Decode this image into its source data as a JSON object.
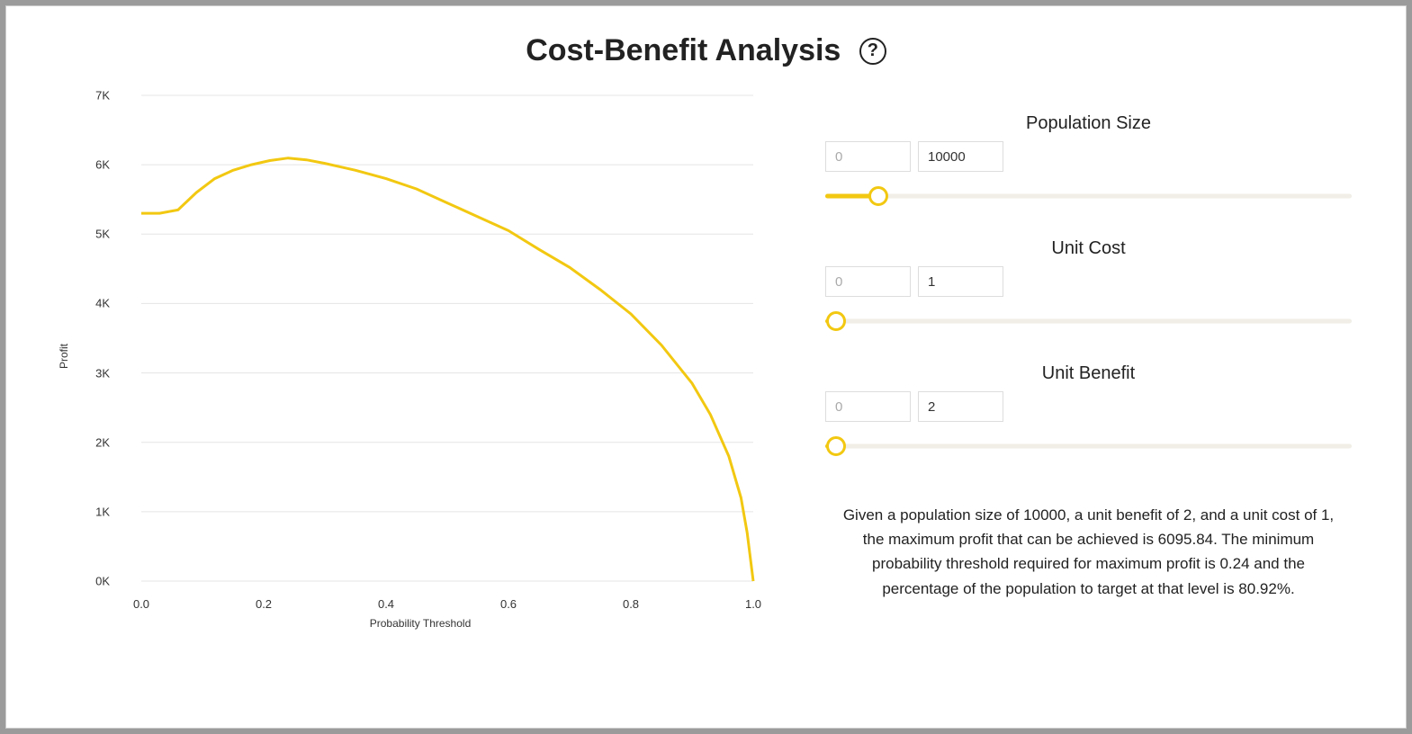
{
  "title": "Cost-Benefit Analysis",
  "help_tooltip": "?",
  "chart_data": {
    "type": "line",
    "xlabel": "Probability Threshold",
    "ylabel": "Profit",
    "xlim": [
      0.0,
      1.0
    ],
    "ylim": [
      0,
      7000
    ],
    "x_ticks": [
      "0.0",
      "0.2",
      "0.4",
      "0.6",
      "0.8",
      "1.0"
    ],
    "y_ticks": [
      "0K",
      "1K",
      "2K",
      "3K",
      "4K",
      "5K",
      "6K",
      "7K"
    ],
    "x": [
      0.0,
      0.03,
      0.06,
      0.09,
      0.12,
      0.15,
      0.18,
      0.21,
      0.24,
      0.27,
      0.3,
      0.35,
      0.4,
      0.45,
      0.5,
      0.55,
      0.6,
      0.65,
      0.7,
      0.75,
      0.8,
      0.85,
      0.9,
      0.93,
      0.96,
      0.98,
      0.99,
      1.0
    ],
    "values": [
      5300,
      5300,
      5350,
      5600,
      5800,
      5920,
      6000,
      6060,
      6095.84,
      6070,
      6020,
      5920,
      5800,
      5650,
      5450,
      5250,
      5050,
      4780,
      4520,
      4200,
      3850,
      3400,
      2850,
      2400,
      1800,
      1200,
      700,
      0
    ]
  },
  "controls": {
    "population": {
      "label": "Population Size",
      "min_placeholder": "0",
      "value": "10000",
      "slider_pct": 10
    },
    "unit_cost": {
      "label": "Unit Cost",
      "min_placeholder": "0",
      "value": "1",
      "slider_pct": 2
    },
    "unit_benefit": {
      "label": "Unit Benefit",
      "min_placeholder": "0",
      "value": "2",
      "slider_pct": 2
    }
  },
  "summary": "Given a population size of 10000, a unit benefit of 2, and a unit cost of 1, the maximum profit that can be achieved is 6095.84. The minimum probability threshold required for maximum profit is 0.24 and the percentage of the population to target at that level is 80.92%."
}
